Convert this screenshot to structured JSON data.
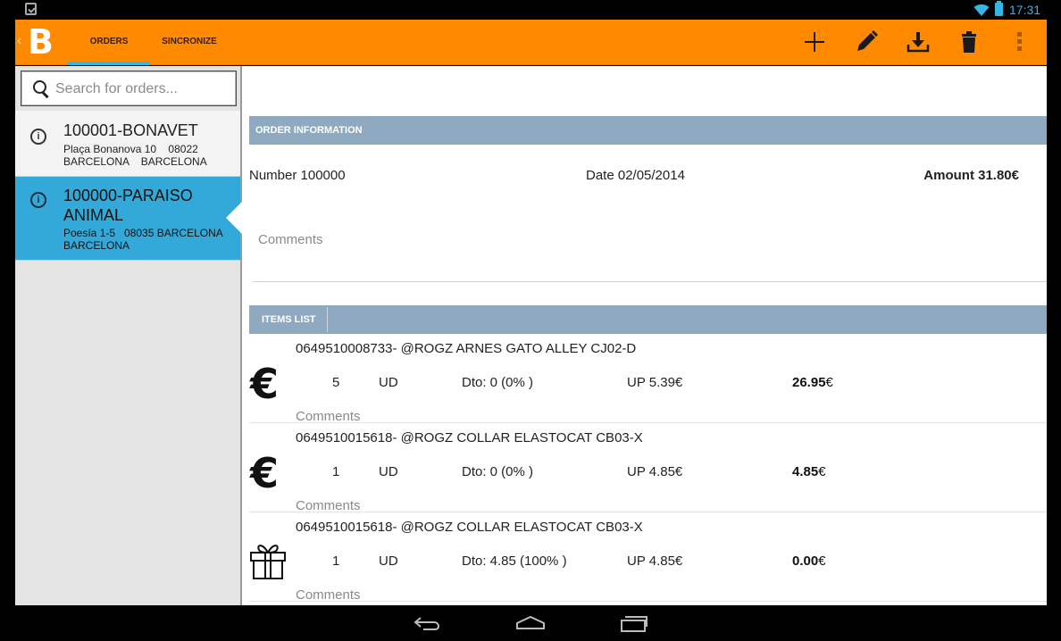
{
  "status_bar": {
    "time": "17:31",
    "icons": [
      "clipboard-check-icon",
      "wifi-icon",
      "battery-icon"
    ],
    "accent_color": "#33b5e5"
  },
  "action_bar": {
    "logo_text": "B",
    "tabs": [
      {
        "label": "ORDERS",
        "selected": true
      },
      {
        "label": "SINCRONIZE",
        "selected": false
      }
    ],
    "actions": [
      "add-icon",
      "edit-icon",
      "download-icon",
      "delete-icon",
      "overflow-menu-icon"
    ],
    "color": "#ff8a00"
  },
  "search": {
    "placeholder": "Search for orders..."
  },
  "orders": [
    {
      "name": "100001-BONAVET",
      "address_line1": "Plaça Bonanova 10    08022",
      "address_line2": "BARCELONA    BARCELONA",
      "selected": false
    },
    {
      "name": "100000-PARAISO ANIMAL",
      "address_line1": "Poesía 1-5   08035 BARCELONA",
      "address_line2": "BARCELONA",
      "selected": true
    }
  ],
  "order_info": {
    "header": "ORDER INFORMATION",
    "number": "Number 100000",
    "date": "Date 02/05/2014",
    "amount": "Amount 31.80€",
    "comments_placeholder": "Comments"
  },
  "items_list": {
    "header": "ITEMS LIST",
    "items": [
      {
        "code": "0649510008733- @ROGZ ARNES GATO ALLEY CJ02-D",
        "type_icon": "euro-icon",
        "qty": "5",
        "unit": "UD",
        "dto": "Dto: 0 (0% )",
        "up": "UP 5.39€",
        "total": "26.95",
        "currency": "€",
        "comments": "Comments"
      },
      {
        "code": "0649510015618- @ROGZ COLLAR ELASTOCAT CB03-X",
        "type_icon": "euro-icon",
        "qty": "1",
        "unit": "UD",
        "dto": "Dto: 0 (0% )",
        "up": "UP 4.85€",
        "total": "4.85",
        "currency": "€",
        "comments": "Comments"
      },
      {
        "code": "0649510015618- @ROGZ COLLAR ELASTOCAT CB03-X",
        "type_icon": "gift-icon",
        "qty": "1",
        "unit": "UD",
        "dto": "Dto: 4.85 (100% )",
        "up": "UP 4.85€",
        "total": "0.00",
        "currency": "€",
        "comments": "Comments"
      }
    ]
  }
}
